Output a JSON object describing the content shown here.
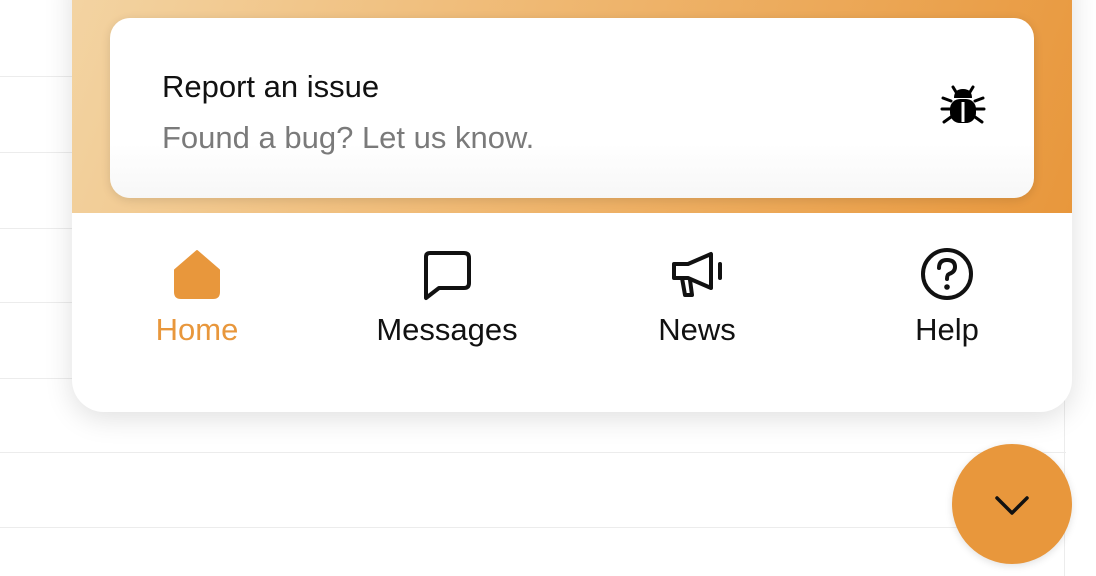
{
  "report_card": {
    "title": "Report an issue",
    "subtitle": "Found a bug? Let us know.",
    "icon": "bug-icon"
  },
  "nav": {
    "items": [
      {
        "label": "Home",
        "icon": "home-icon",
        "active": true
      },
      {
        "label": "Messages",
        "icon": "message-icon",
        "active": false
      },
      {
        "label": "News",
        "icon": "megaphone-icon",
        "active": false
      },
      {
        "label": "Help",
        "icon": "help-icon",
        "active": false
      }
    ]
  },
  "launcher": {
    "icon": "chevron-down-icon"
  },
  "colors": {
    "accent": "#e8973c",
    "header_gradient_start": "#f3d4a3",
    "header_gradient_end": "#e8973c",
    "text_primary": "#111111",
    "text_secondary": "#7a7a7a"
  }
}
